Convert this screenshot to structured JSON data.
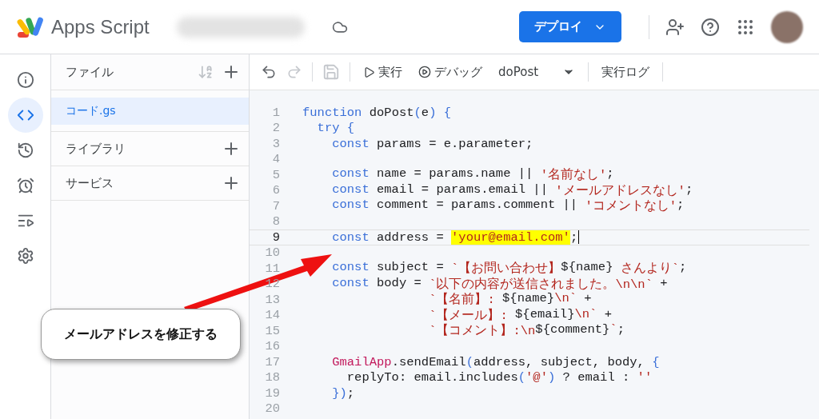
{
  "header": {
    "product": "Apps Script",
    "deploy_button": "デプロイ"
  },
  "rail": [
    {
      "kind": "info",
      "selected": false
    },
    {
      "kind": "editor",
      "selected": true
    },
    {
      "kind": "history",
      "selected": false
    },
    {
      "kind": "triggers",
      "selected": false
    },
    {
      "kind": "executions",
      "selected": false
    },
    {
      "kind": "settings",
      "selected": false
    }
  ],
  "files_panel": {
    "title": "ファイル",
    "files": [
      {
        "name": "コード.gs",
        "selected": true
      }
    ],
    "sections": [
      {
        "label": "ライブラリ"
      },
      {
        "label": "サービス"
      }
    ]
  },
  "toolbar": {
    "redo_disabled": true,
    "save_disabled": true,
    "run": "実行",
    "debug": "デバッグ",
    "function": "doPost",
    "log": "実行ログ"
  },
  "editor": {
    "lines": [
      {
        "number": "1",
        "current": false,
        "tokens": [
          {
            "kind": "keyword",
            "text": "function"
          },
          {
            "kind": "plain",
            "text": " doPost"
          },
          {
            "kind": "bracket",
            "text": "("
          },
          {
            "kind": "plain",
            "text": "e"
          },
          {
            "kind": "bracket",
            "text": ") {"
          }
        ]
      },
      {
        "number": "2",
        "current": false,
        "tokens": [
          {
            "kind": "keyword",
            "text": "  try"
          },
          {
            "kind": "bracket",
            "text": " {"
          }
        ]
      },
      {
        "number": "3",
        "current": false,
        "tokens": [
          {
            "kind": "keyword",
            "text": "    const"
          },
          {
            "kind": "plain",
            "text": " params = e.parameter;"
          }
        ]
      },
      {
        "number": "4",
        "current": false
      },
      {
        "number": "5",
        "current": false,
        "tokens": [
          {
            "kind": "keyword",
            "text": "    const"
          },
          {
            "kind": "plain",
            "text": " name = params.name || "
          },
          {
            "kind": "string",
            "text": "'名前なし'"
          },
          {
            "kind": "plain",
            "text": ";"
          }
        ]
      },
      {
        "number": "6",
        "current": false,
        "tokens": [
          {
            "kind": "keyword",
            "text": "    const"
          },
          {
            "kind": "plain",
            "text": " email = params.email || "
          },
          {
            "kind": "string",
            "text": "'メールアドレスなし'"
          },
          {
            "kind": "plain",
            "text": ";"
          }
        ]
      },
      {
        "number": "7",
        "current": false,
        "tokens": [
          {
            "kind": "keyword",
            "text": "    const"
          },
          {
            "kind": "plain",
            "text": " comment = params.comment || "
          },
          {
            "kind": "string",
            "text": "'コメントなし'"
          },
          {
            "kind": "plain",
            "text": ";"
          }
        ]
      },
      {
        "number": "8",
        "current": false
      },
      {
        "number": "9",
        "current": true,
        "tokens": [
          {
            "kind": "keyword",
            "text": "    const"
          },
          {
            "kind": "plain",
            "text": " address = "
          },
          {
            "kind": "highlight",
            "text": "'your@email.com'"
          },
          {
            "kind": "plain",
            "text": ";"
          }
        ]
      },
      {
        "number": "10",
        "current": false
      },
      {
        "number": "11",
        "current": false,
        "tokens": [
          {
            "kind": "keyword",
            "text": "    const"
          },
          {
            "kind": "plain",
            "text": " subject = "
          },
          {
            "kind": "string",
            "text": "`【お問い合わせ】"
          },
          {
            "kind": "plain",
            "text": "${name}"
          },
          {
            "kind": "string",
            "text": " さんより`"
          },
          {
            "kind": "plain",
            "text": ";"
          }
        ]
      },
      {
        "number": "12",
        "current": false,
        "tokens": [
          {
            "kind": "keyword",
            "text": "    const"
          },
          {
            "kind": "plain",
            "text": " body = "
          },
          {
            "kind": "string",
            "text": "`以下の内容が送信されました。\\n\\n`"
          },
          {
            "kind": "plain",
            "text": " +"
          }
        ]
      },
      {
        "number": "13",
        "current": false,
        "tokens": [
          {
            "kind": "string",
            "text": "                 `【名前】: "
          },
          {
            "kind": "plain",
            "text": "${name}"
          },
          {
            "kind": "string",
            "text": "\\n`"
          },
          {
            "kind": "plain",
            "text": " +"
          }
        ]
      },
      {
        "number": "14",
        "current": false,
        "tokens": [
          {
            "kind": "string",
            "text": "                 `【メール】: "
          },
          {
            "kind": "plain",
            "text": "${email}"
          },
          {
            "kind": "string",
            "text": "\\n`"
          },
          {
            "kind": "plain",
            "text": " +"
          }
        ]
      },
      {
        "number": "15",
        "current": false,
        "tokens": [
          {
            "kind": "string",
            "text": "                 `【コメント】:\\n"
          },
          {
            "kind": "plain",
            "text": "${comment}"
          },
          {
            "kind": "string",
            "text": "`"
          },
          {
            "kind": "plain",
            "text": ";"
          }
        ]
      },
      {
        "number": "16",
        "current": false
      },
      {
        "number": "17",
        "current": false,
        "tokens": [
          {
            "kind": "class",
            "text": "    GmailApp"
          },
          {
            "kind": "plain",
            "text": ".sendEmail"
          },
          {
            "kind": "bracket",
            "text": "("
          },
          {
            "kind": "plain",
            "text": "address, subject, body, "
          },
          {
            "kind": "bracket",
            "text": "{"
          }
        ]
      },
      {
        "number": "18",
        "current": false,
        "tokens": [
          {
            "kind": "plain",
            "text": "      replyTo: email.includes"
          },
          {
            "kind": "bracket",
            "text": "("
          },
          {
            "kind": "string",
            "text": "'@'"
          },
          {
            "kind": "bracket",
            "text": ")"
          },
          {
            "kind": "plain",
            "text": " ? email : "
          },
          {
            "kind": "string",
            "text": "''"
          }
        ]
      },
      {
        "number": "19",
        "current": false,
        "tokens": [
          {
            "kind": "bracket",
            "text": "    })"
          },
          {
            "kind": "plain",
            "text": ";"
          }
        ]
      },
      {
        "number": "20",
        "current": false
      }
    ]
  },
  "callout": {
    "text": "メールアドレスを修正する"
  }
}
